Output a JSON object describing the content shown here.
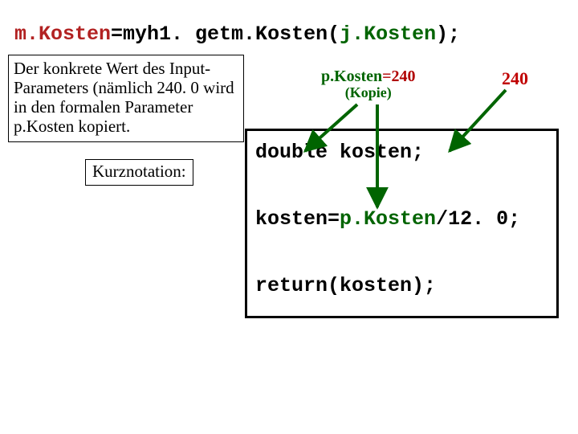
{
  "title_parts": {
    "mk": "m.Kosten",
    "rest1": "=myh1. getm.Kosten(",
    "arg": "j.Kosten",
    "rest2": ");"
  },
  "explain": "Der konkrete Wert des Input-Parameters (nämlich 240. 0 wird in den formalen Parameter p.Kosten kopiert.",
  "kurz": "Kurznotation:",
  "label": {
    "pk": "p.Kosten",
    "eqval": "=240",
    "sub": "(Kopie)"
  },
  "value_240": "240",
  "code": {
    "l1": "double kosten;",
    "l2_a": "kosten=",
    "l2_b": "p.Kosten",
    "l2_c": "/12. 0;",
    "l3": "return(kosten);"
  }
}
